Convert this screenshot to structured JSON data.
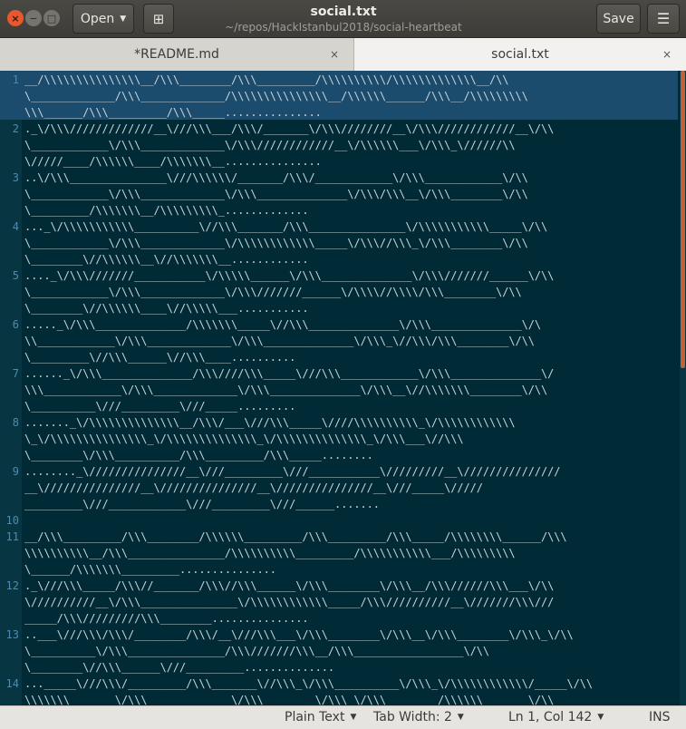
{
  "window": {
    "title": "social.txt",
    "subtitle": "~/repos/HackIstanbul2018/social-heartbeat",
    "open_label": "Open",
    "save_label": "Save"
  },
  "tabs": [
    {
      "label": "*README.md",
      "close": "×"
    },
    {
      "label": "social.txt",
      "close": "×"
    }
  ],
  "editor": {
    "lines": [
      {
        "n": "1",
        "wrapped": [
          "__/\\\\\\\\\\\\\\\\\\\\\\\\\\\\\\__/\\\\\\________/\\\\\\_________/\\\\\\\\\\\\\\\\\\\\/\\\\\\\\\\\\\\\\\\\\\\\\\\__/\\\\",
          "\\_____________/\\\\\\_____________/\\\\\\\\\\\\\\\\\\\\\\\\\\\\\\__/\\\\\\\\\\\\______/\\\\\\__/\\\\\\\\\\\\\\\\\\",
          "\\\\\\______/\\\\\\_________/\\\\\\_____..............."
        ]
      },
      {
        "n": "2",
        "wrapped": [
          "._\\/\\\\\\/////////////__\\///\\\\\\___/\\\\\\/_______\\/\\\\\\////////__\\/\\\\\\////////////__\\/\\\\",
          "\\____________\\/\\\\\\_____________\\/\\\\\\////////////__\\/\\\\\\\\\\\\___\\/\\\\\\_\\//////\\\\",
          "\\/////____/\\\\\\\\\\\\____/\\\\\\\\\\\\\\__..............."
        ]
      },
      {
        "n": "3",
        "wrapped": [
          "..\\/\\\\\\_______________\\///\\\\\\\\\\\\/_______/\\\\\\/____________\\/\\\\\\____________\\/\\\\",
          "\\____________\\/\\\\\\_____________\\/\\\\\\______________\\/\\\\\\/\\\\\\__\\/\\\\\\________\\/\\\\",
          "\\_________/\\\\\\\\\\\\\\__/\\\\\\\\\\\\\\\\\\_............."
        ]
      },
      {
        "n": "4",
        "wrapped": [
          "..._\\/\\\\\\\\\\\\\\\\\\\\\\__________\\//\\\\\\_______/\\\\\\_______________\\/\\\\\\\\\\\\\\\\\\\\\\_____\\/\\\\",
          "\\____________\\/\\\\\\_____________\\/\\\\\\\\\\\\\\\\\\\\\\\\_____\\/\\\\\\//\\\\\\_\\/\\\\\\________\\/\\\\",
          "\\________\\//\\\\\\\\\\\\__\\//\\\\\\\\\\\\\\__............"
        ]
      },
      {
        "n": "5",
        "wrapped": [
          "...._\\/\\\\\\///////___________\\/\\\\\\\\\\______\\/\\\\\\______________\\/\\\\\\///////______\\/\\\\",
          "\\____________\\/\\\\\\_____________\\/\\\\\\///////______\\/\\\\\\\\//\\\\\\\\/\\\\\\________\\/\\\\",
          "\\________\\//\\\\\\\\\\\\____\\//\\\\\\\\\\___..........."
        ]
      },
      {
        "n": "6",
        "wrapped": [
          "....._\\/\\\\\\______________/\\\\\\\\\\\\\\_____\\//\\\\\\______________\\/\\\\\\______________\\/\\",
          "\\\\____________\\/\\\\\\_____________\\/\\\\\\______________\\/\\\\\\_\\//\\\\\\/\\\\\\________\\/\\\\",
          "\\_________\\//\\\\\\______\\//\\\\\\____.........."
        ]
      },
      {
        "n": "7",
        "wrapped": [
          "......_\\/\\\\\\______________/\\\\\\////\\\\\\_____\\///\\\\\\____________\\/\\\\\\______________\\/",
          "\\\\\\____________\\/\\\\\\_____________\\/\\\\\\______________\\/\\\\\\__\\//\\\\\\\\\\\\\\________\\/\\\\",
          "\\__________\\///_________\\///_____........."
        ]
      },
      {
        "n": "8",
        "wrapped": [
          "......._\\/\\\\\\\\\\\\\\\\\\\\\\\\\\\\__/\\\\\\/___\\///\\\\\\_____\\////\\\\\\\\\\\\\\\\\\\\_\\/\\\\\\\\\\\\\\\\\\\\\\\\",
          "\\_\\/\\\\\\\\\\\\\\\\\\\\\\\\\\\\\\_\\/\\\\\\\\\\\\\\\\\\\\\\\\\\\\_\\/\\\\\\\\\\\\\\\\\\\\\\\\\\\\_\\/\\\\\\___\\//\\\\\\",
          "\\________\\/\\\\\\__________/\\\\\\_________/\\\\\\_____........"
        ]
      },
      {
        "n": "9",
        "wrapped": [
          "........_\\///////////////__\\///_________\\///___________\\/////////__\\///////////////",
          "__\\///////////////__\\///////////////__\\///////////////__\\///_____\\/////",
          "_________\\///____________\\///_________\\///______......."
        ]
      },
      {
        "n": "10",
        "wrapped": [
          ""
        ]
      },
      {
        "n": "11",
        "wrapped": [
          "__/\\\\\\_________/\\\\\\________/\\\\\\\\\\\\_________/\\\\\\_________/\\\\\\_____/\\\\\\\\\\\\\\\\______/\\\\\\",
          "\\\\\\\\\\\\\\\\\\\\__/\\\\\\_______________/\\\\\\\\\\\\\\\\\\\\_________/\\\\\\\\\\\\\\\\\\\\\\___/\\\\\\\\\\\\\\\\\\",
          "\\______/\\\\\\\\\\\\\\_________..............."
        ]
      },
      {
        "n": "12",
        "wrapped": [
          "._\\///\\\\\\_____/\\\\\\//_______/\\\\\\//\\\\\\______\\/\\\\\\________\\/\\\\\\__/\\\\\\//////\\\\\\___\\/\\\\",
          "\\//////////__\\/\\\\\\_______________\\/\\\\\\\\\\\\\\\\\\\\\\\\_____/\\\\\\//////////__\\///////\\\\\\///",
          "_____/\\\\\\/////////\\\\\\________..............."
        ]
      },
      {
        "n": "13",
        "wrapped": [
          "..___\\///\\\\\\/\\\\\\/________/\\\\\\/__\\///\\\\\\___\\/\\\\\\________\\/\\\\\\__\\/\\\\\\________\\/\\\\\\_\\/\\\\",
          "\\__________\\/\\\\\\_______________/\\\\\\///////\\\\\\__/\\\\\\_________________\\/\\\\",
          "\\________\\//\\\\\\______\\///_________.............."
        ]
      },
      {
        "n": "14",
        "wrapped": [
          "..._____\\///\\\\\\/_________/\\\\\\_______\\//\\\\\\_\\/\\\\\\__________\\/\\\\\\_\\/\\\\\\\\\\\\\\\\\\\\\\\\/_____\\/\\\\",
          "\\\\\\\\\\\\\\_______\\/\\\\\\_____________\\/\\\\\\________\\/\\\\\\_\\/\\\\\\________/\\\\\\\\\\\\_______\\/\\\\"
        ]
      }
    ]
  },
  "statusbar": {
    "syntax": "Plain Text",
    "tab_width": "Tab Width: 2",
    "position": "Ln 1, Col 142",
    "mode": "INS"
  }
}
